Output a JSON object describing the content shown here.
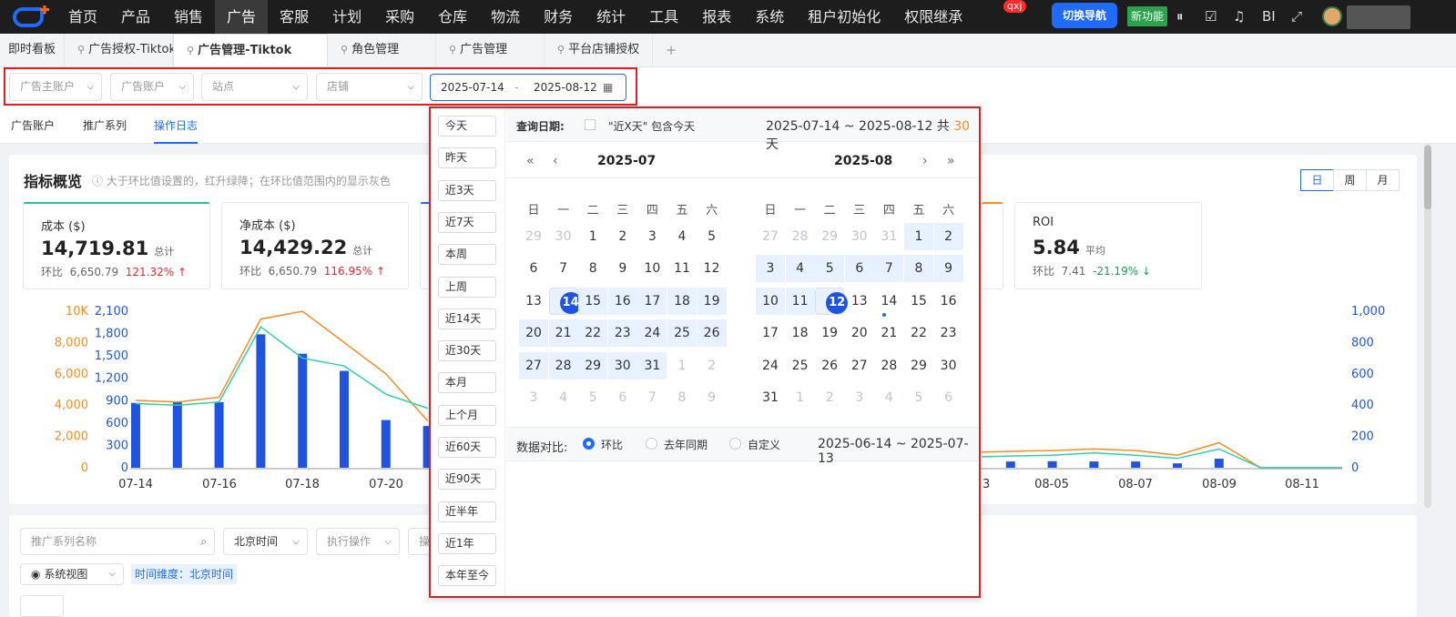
{
  "topnav": {
    "items": [
      "首页",
      "产品",
      "销售",
      "广告",
      "客服",
      "计划",
      "采购",
      "仓库",
      "物流",
      "财务",
      "统计",
      "工具",
      "报表",
      "系统",
      "租户初始化",
      "权限继承"
    ],
    "active_index": 3,
    "badge": "qxj",
    "switch_nav": "切换导航",
    "new_feature": "新功能",
    "tool_icons": [
      "pause-icon",
      "calendar-check-icon",
      "bell-icon",
      "bi-text",
      "fullscreen-icon"
    ],
    "bi_label": "BI"
  },
  "tabs": {
    "dashboard": "即时看板",
    "items": [
      "广告授权-Tiktok",
      "广告管理-Tiktok",
      "角色管理",
      "广告管理",
      "平台店铺授权"
    ],
    "active_index": 1,
    "add": "+"
  },
  "filters": {
    "advertiser_main": "广告主账户",
    "ad_account": "广告账户",
    "site": "站点",
    "shop": "店铺",
    "start_date": "2025-07-14",
    "end_date": "2025-08-12",
    "sep": "-"
  },
  "subtabs": [
    "广告账户",
    "推广系列",
    "操作日志"
  ],
  "subtabs_active": 2,
  "overview": {
    "title": "指标概览",
    "hint": "大于环比值设置的，红升绿降；在环比值范围内的显示灰色",
    "granularity": [
      "日",
      "周",
      "月"
    ],
    "granularity_active": 0
  },
  "metrics": [
    {
      "label": "成本 ($)",
      "value": "14,719.81",
      "unit": "总计",
      "cmp_label": "环比",
      "cmp_value": "6,650.79",
      "change": "121.32%",
      "dir": "up",
      "accent": "#20c997"
    },
    {
      "label": "净成本 ($)",
      "value": "14,429.22",
      "unit": "总计",
      "cmp_label": "环比",
      "cmp_value": "6,650.79",
      "change": "116.95%",
      "dir": "up",
      "accent": "#ffffff"
    },
    {
      "label": "ROI",
      "value": "5.84",
      "unit": "平均",
      "cmp_label": "环比",
      "cmp_value": "7.41",
      "change": "-21.19%",
      "dir": "down",
      "accent": "#ffffff"
    }
  ],
  "chart_data": {
    "type": "bar",
    "x_ticks_visible": [
      "07-14",
      "07-16",
      "07-18",
      "07-20",
      "08-05",
      "08-07",
      "08-09",
      "08-11"
    ],
    "partial_tick": "3",
    "left_axis_1": [
      "10K",
      "8,000",
      "6,000",
      "4,000",
      "2,000",
      "0"
    ],
    "left_axis_2": [
      "2,100",
      "1,800",
      "1,500",
      "1,200",
      "900",
      "600",
      "300",
      "0"
    ],
    "right_axis": [
      "1,000",
      "800",
      "600",
      "400",
      "200",
      "0"
    ],
    "colors": {
      "bars": "#1f54e3",
      "line_orange": "#ff8a1f",
      "line_teal": "#2ad1b0"
    },
    "left_bars": {
      "x": [
        "07-14",
        "07-15",
        "07-16",
        "07-17",
        "07-18",
        "07-19",
        "07-20",
        "07-21"
      ],
      "values": [
        870,
        880,
        880,
        1790,
        1530,
        1300,
        640,
        560
      ]
    },
    "left_orange": [
      4300,
      4200,
      4500,
      9500,
      10000,
      8000,
      6000,
      3000
    ],
    "left_teal": [
      4100,
      4000,
      4200,
      9000,
      7000,
      6500,
      4700,
      3800
    ],
    "right_bars": {
      "x": [
        "08-04",
        "08-05",
        "08-06",
        "08-07",
        "08-08",
        "08-09",
        "08-10",
        "08-11"
      ],
      "values": [
        38,
        40,
        42,
        40,
        40,
        28,
        58,
        0
      ]
    },
    "right_orange": [
      100,
      105,
      110,
      120,
      110,
      80,
      160,
      0
    ],
    "right_teal": [
      70,
      75,
      80,
      95,
      80,
      60,
      120,
      0
    ]
  },
  "bottom": {
    "search_placeholder": "推广系列名称",
    "timezone": "北京时间",
    "operation": "执行操作",
    "more": "操",
    "system_view": "系统视图",
    "time_dim": "时间维度：北京时间"
  },
  "picker": {
    "shortcuts": [
      "今天",
      "昨天",
      "近3天",
      "近7天",
      "本周",
      "上周",
      "近14天",
      "近30天",
      "本月",
      "上个月",
      "近60天",
      "近90天",
      "近半年",
      "近1年",
      "本年至今"
    ],
    "query_label": "查询日期:",
    "include_today": "\"近X天\" 包含今天",
    "range_text": "2025-07-14 ~ 2025-08-12",
    "total_pre": "共",
    "total_days": "30",
    "total_post": "天",
    "weekdays": [
      "日",
      "一",
      "二",
      "三",
      "四",
      "五",
      "六"
    ],
    "left_title": "2025-07",
    "right_title": "2025-08",
    "nav": {
      "prev_year": "«",
      "prev_month": "‹",
      "next_month": "›",
      "next_year": "»"
    },
    "left_days": [
      [
        "29",
        "30",
        "1",
        "2",
        "3",
        "4",
        "5"
      ],
      [
        "6",
        "7",
        "8",
        "9",
        "10",
        "11",
        "12"
      ],
      [
        "13",
        "14",
        "15",
        "16",
        "17",
        "18",
        "19"
      ],
      [
        "20",
        "21",
        "22",
        "23",
        "24",
        "25",
        "26"
      ],
      [
        "27",
        "28",
        "29",
        "30",
        "31",
        "1",
        "2"
      ],
      [
        "3",
        "4",
        "5",
        "6",
        "7",
        "8",
        "9"
      ]
    ],
    "right_days": [
      [
        "27",
        "28",
        "29",
        "30",
        "31",
        "1",
        "2"
      ],
      [
        "3",
        "4",
        "5",
        "6",
        "7",
        "8",
        "9"
      ],
      [
        "10",
        "11",
        "12",
        "13",
        "14",
        "15",
        "16"
      ],
      [
        "17",
        "18",
        "19",
        "20",
        "21",
        "22",
        "23"
      ],
      [
        "24",
        "25",
        "26",
        "27",
        "28",
        "29",
        "30"
      ],
      [
        "31",
        "1",
        "2",
        "3",
        "4",
        "5",
        "6"
      ]
    ],
    "compare_label": "数据对比:",
    "compare_options": [
      "环比",
      "去年同期",
      "自定义"
    ],
    "compare_selected": 0,
    "compare_range": "2025-06-14 ~ 2025-07-13"
  }
}
